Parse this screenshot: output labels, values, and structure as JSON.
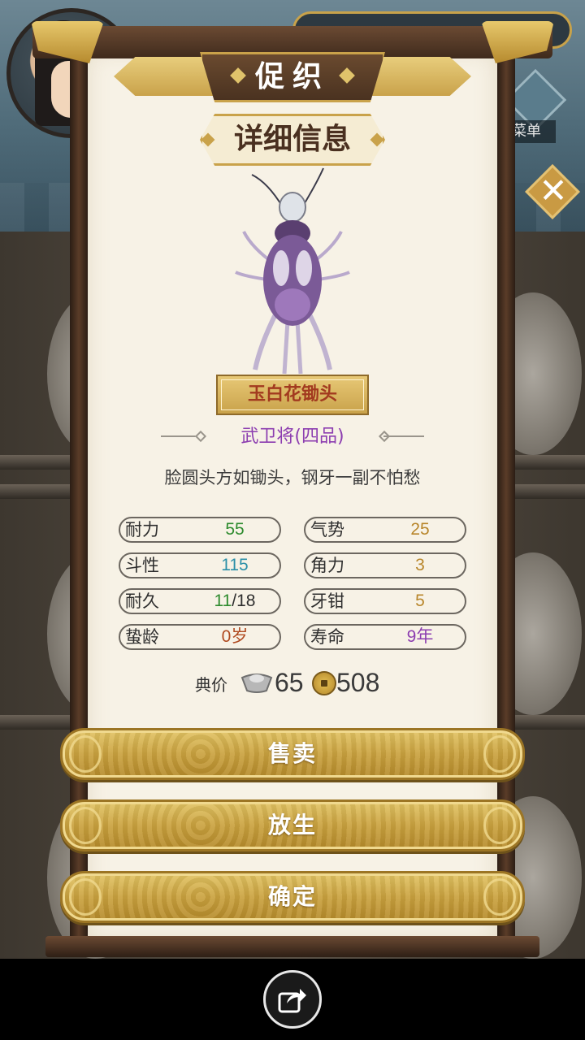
{
  "header": {
    "title": "促织",
    "section_title": "详细信息",
    "menu_label": "菜单"
  },
  "cricket": {
    "name": "玉白花锄头",
    "rank": "武卫将(四品)",
    "description": "脸圆头方如锄头，钢牙一副不怕愁"
  },
  "stats": [
    {
      "label": "耐力",
      "value": "55",
      "color": "#2e8b2e"
    },
    {
      "label": "气势",
      "value": "25",
      "color": "#b8862b"
    },
    {
      "label": "斗性",
      "value": "115",
      "color": "#2a8fa8"
    },
    {
      "label": "角力",
      "value": "3",
      "color": "#b8862b"
    },
    {
      "label": "耐久",
      "value_a": "11",
      "value_b": "/18",
      "color": "#2e8b2e"
    },
    {
      "label": "牙钳",
      "value": "5",
      "color": "#b8862b"
    },
    {
      "label": "蛰龄",
      "value": "0岁",
      "color": "#b04a20"
    },
    {
      "label": "寿命",
      "value": "9年",
      "color": "#8c3db0"
    }
  ],
  "price": {
    "label": "典价",
    "silver": "65",
    "copper": "508"
  },
  "buttons": {
    "sell": "售卖",
    "release": "放生",
    "confirm": "确定"
  },
  "colors": {
    "gold": "#c9a24a",
    "paper": "#f7f2e6",
    "wood": "#4a3220"
  }
}
